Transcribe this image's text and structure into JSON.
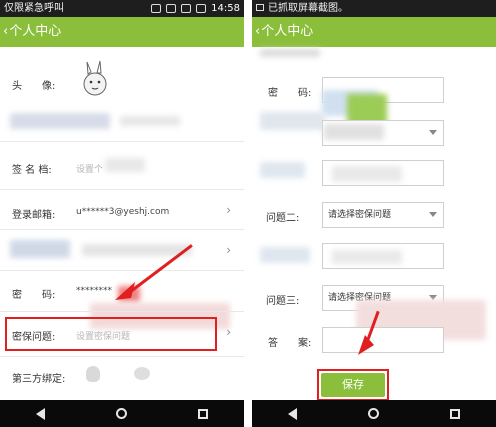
{
  "left": {
    "status_bar": {
      "carrier": "仅限紧急呼叫",
      "time": "14:58"
    },
    "header": {
      "back_icon": "chevron-left-icon",
      "title": "个人中心"
    },
    "rows": {
      "avatar_label": "头　　像:",
      "signature_label": "签 名 档:",
      "signature_placeholder": "设置个",
      "email_label": "登录邮箱:",
      "email_value": "u******3@yeshj.com",
      "password_label": "密　　码:",
      "password_value": "********",
      "security_question_label": "密保问题:",
      "security_question_placeholder": "设置密保问题",
      "third_party_label": "第三方绑定:"
    }
  },
  "right": {
    "status_bar": {
      "notice": "已抓取屏幕截图。"
    },
    "header": {
      "back_icon": "chevron-left-icon",
      "title": "个人中心"
    },
    "form": {
      "password_label": "密　　码:",
      "question2_label": "问题二:",
      "question2_placeholder": "请选择密保问题",
      "question3_label": "问题三:",
      "question3_placeholder": "请选择密保问题",
      "answer_label": "答　　案:",
      "save_label": "保存"
    }
  },
  "colors": {
    "accent": "#8bbf3b",
    "annotation": "#e02020"
  }
}
